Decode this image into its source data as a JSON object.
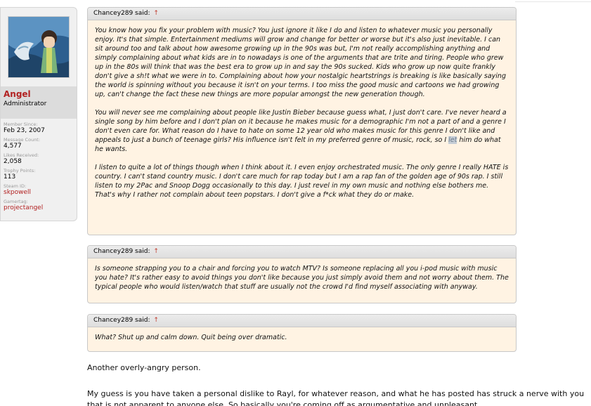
{
  "user": {
    "name": "Angel",
    "title": "Administrator",
    "stats": [
      {
        "label": "Member Since:",
        "value": "Feb 23, 2007",
        "link": false
      },
      {
        "label": "Message Count:",
        "value": "4,577",
        "link": false
      },
      {
        "label": "Likes Received:",
        "value": "2,058",
        "link": false
      },
      {
        "label": "Trophy Points:",
        "value": "113",
        "link": false
      },
      {
        "label": "Steam ID:",
        "value": "skpowell",
        "link": true
      },
      {
        "label": "Gamertag:",
        "value": "projectangel",
        "link": true
      }
    ]
  },
  "quotes": [
    {
      "attribution": "Chancey289 said:",
      "arrow": "↑",
      "paragraphs": [
        "You know how you fix your problem with music? You just ignore it like I do and listen to whatever music you personally enjoy. It's that simple. Entertainment mediums will grow and change for better or worse but it's also just inevitable. I can sit around too and talk about how awesome growing up in the 90s was but, I'm not really accomplishing anything and simply complaining about what kids are in to nowadays is one of the arguments that are trite and tiring. People who grew up in the 80s will think that was the best era to grow up in and say the 90s sucked. Kids who grow up now quite frankly don't give a sh!t what we were in to. Complaining about how your nostalgic heartstrings is breaking is like basically saying the world is spinning without you because it isn't on your terms. I too miss the good music and cartoons we had growing up, can't change the fact these new things are more popular amongst the new generation though.",
        "You will never see me complaining about people like Justin Bieber because guess what, I just don't care. I've never heard a single song by him before and I don't plan on it because he makes music for a demographic I'm not a part of and a genre I don't even care for. What reason do I have to hate on some 12 year old who makes music for this genre I don't like and appeals to just a bunch of teenage girls? His influence isn't felt in my preferred genre of music, rock, so I let him do what he wants.",
        "I listen to quite a lot of things though when I think about it. I even enjoy orchestrated music. The only genre I really HATE is country. I can't stand country music. I don't care much for rap today but I am a rap fan of the golden age of 90s rap. I still listen to my 2Pac and Snoop Dogg occasionally to this day. I just revel in my own music and nothing else bothers me. That's why I rather not complain about teen popstars. I don't give a f*ck what they do or make."
      ]
    },
    {
      "attribution": "Chancey289 said:",
      "arrow": "↑",
      "paragraphs": [
        "Is someone strapping you to a chair and forcing you to watch MTV? Is someone replacing all you i-pod music with music you hate? It's rather easy to avoid things you don't like because you just simply avoid them and not worry about them. The typical people who would listen/watch that stuff are usually not the crowd I'd find myself associating with anyway."
      ]
    },
    {
      "attribution": "Chancey289 said:",
      "arrow": "↑",
      "paragraphs": [
        "What? Shut up and calm down. Quit being over dramatic."
      ]
    }
  ],
  "reply": {
    "line1": "Another overly-angry person.",
    "line2": "My guess is you have taken a personal dislike to Rayl, for whatever reason, and what he has posted has struck a nerve with you that is not apparent to anyone else. So basically you're coming off as argumentative and unpleasant."
  },
  "colors": {
    "quote_bg": "#fff3e3",
    "username": "#b22222",
    "link": "#b22222"
  }
}
